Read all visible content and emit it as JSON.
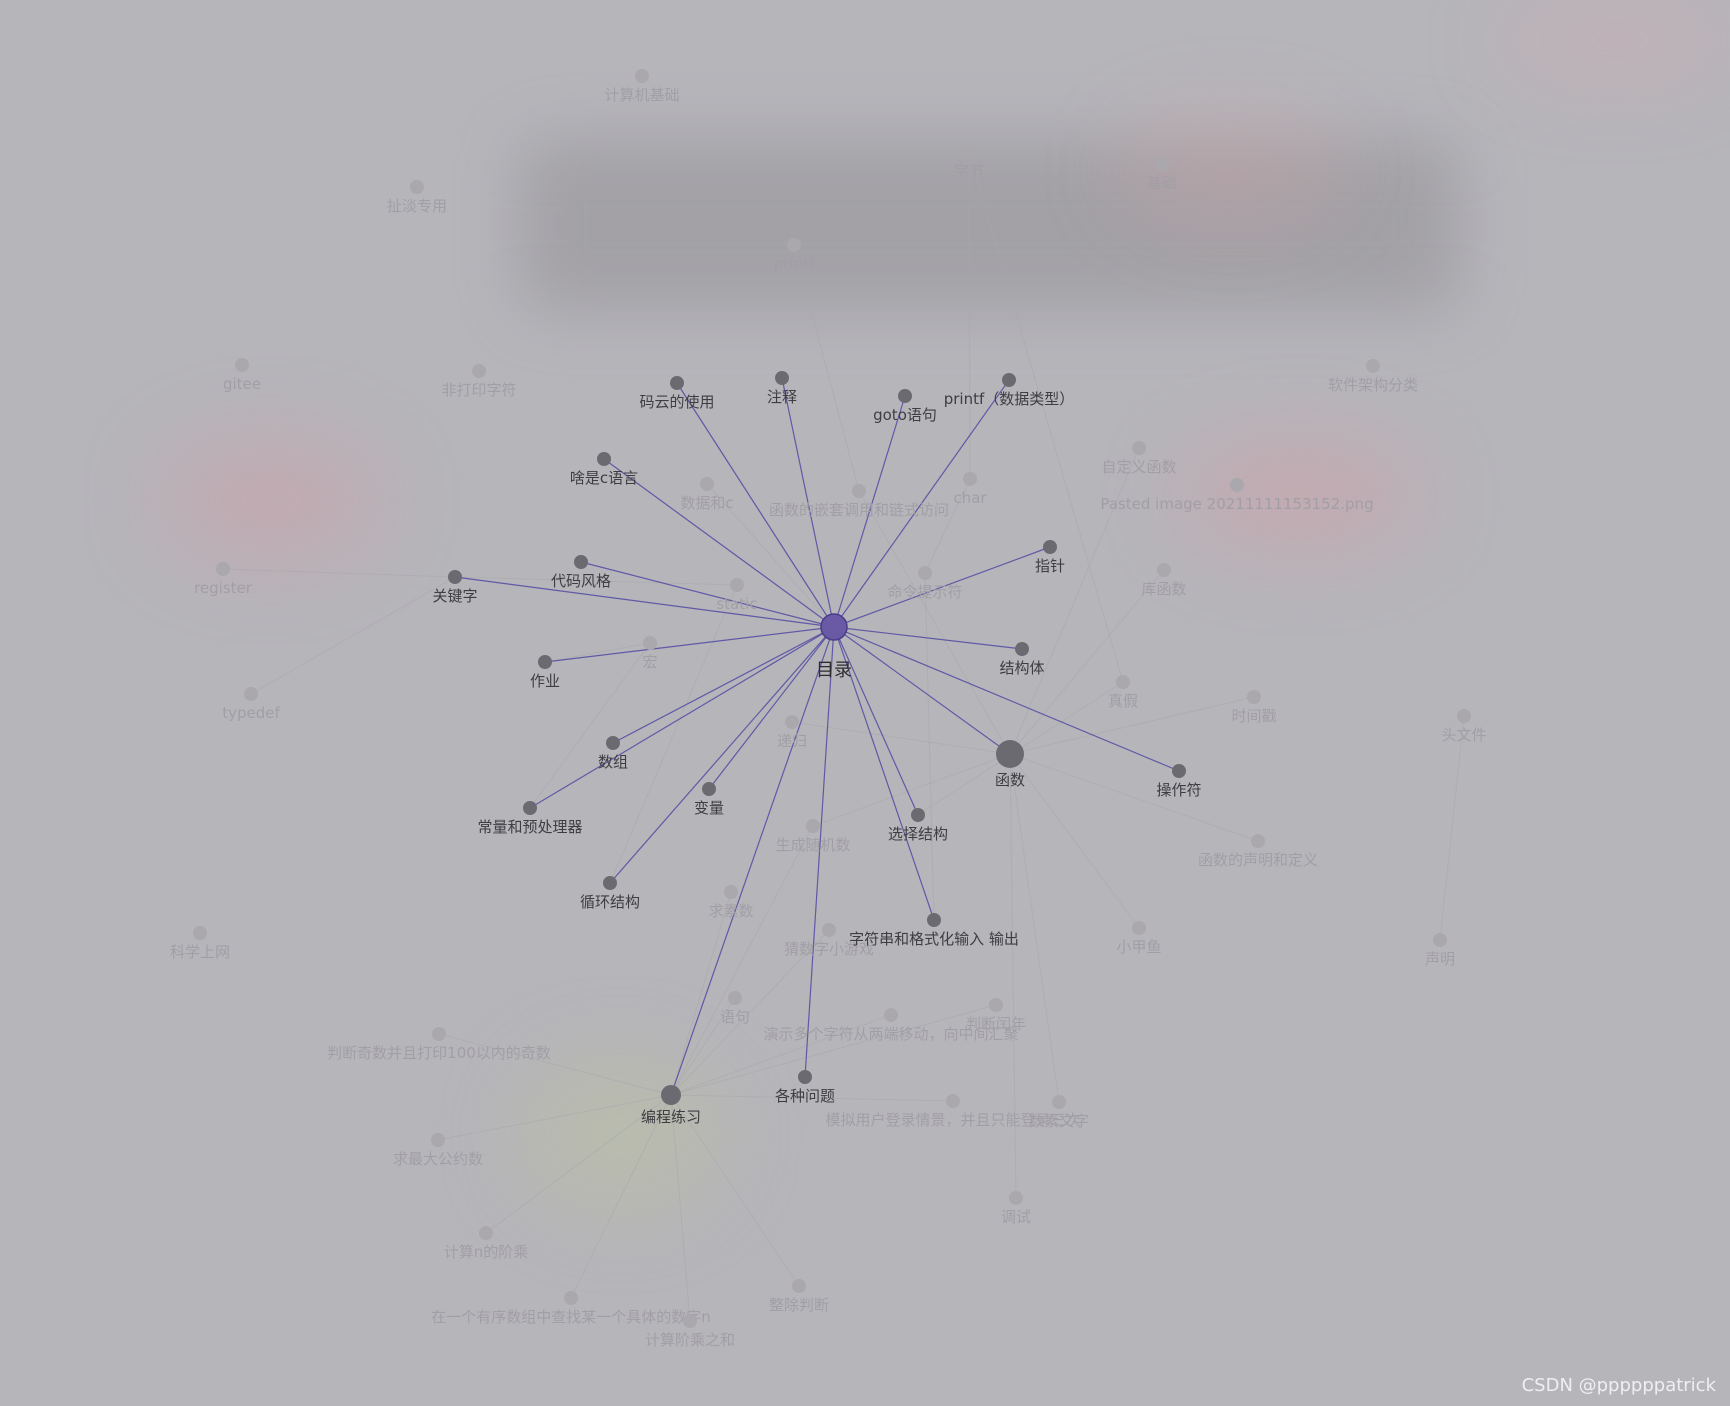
{
  "graph": {
    "center": {
      "id": "mulu",
      "label": "目录"
    },
    "active_nodes": [
      {
        "id": "mayun",
        "label": "码云的使用"
      },
      {
        "id": "zhushi",
        "label": "注释"
      },
      {
        "id": "goto",
        "label": "goto语句"
      },
      {
        "id": "printf_types",
        "label": "printf（数据类型）"
      },
      {
        "id": "c_lang",
        "label": "啥是c语言"
      },
      {
        "id": "zhizhen",
        "label": "指针"
      },
      {
        "id": "daima",
        "label": "代码风格"
      },
      {
        "id": "guanjianzi",
        "label": "关键字"
      },
      {
        "id": "jiegouti",
        "label": "结构体"
      },
      {
        "id": "zuoye",
        "label": "作业"
      },
      {
        "id": "hanshu",
        "label": "函数"
      },
      {
        "id": "caozuofu",
        "label": "操作符"
      },
      {
        "id": "shuzu",
        "label": "数组"
      },
      {
        "id": "bianliang",
        "label": "变量"
      },
      {
        "id": "xuanze",
        "label": "选择结构"
      },
      {
        "id": "changliang",
        "label": "常量和预处理器"
      },
      {
        "id": "xunhuan",
        "label": "循环结构"
      },
      {
        "id": "zifuchuan",
        "label": "字符串和格式化输入 输出"
      },
      {
        "id": "gezhong",
        "label": "各种问题"
      },
      {
        "id": "biancheng",
        "label": "编程练习"
      }
    ],
    "faint_nodes": [
      {
        "id": "jisuanji",
        "label": "计算机基础"
      },
      {
        "id": "zijie",
        "label": "字节"
      },
      {
        "id": "jichu",
        "label": "基础"
      },
      {
        "id": "chedan",
        "label": "扯淡专用"
      },
      {
        "id": "printf",
        "label": "printf"
      },
      {
        "id": "gitee",
        "label": "gitee"
      },
      {
        "id": "feida",
        "label": "非打印字符"
      },
      {
        "id": "ruanjian",
        "label": "软件架构分类"
      },
      {
        "id": "zidingyi",
        "label": "自定义函数"
      },
      {
        "id": "shujuhe",
        "label": "数据和c"
      },
      {
        "id": "qiantao",
        "label": "函数的嵌套调用和链式访问"
      },
      {
        "id": "char",
        "label": "char"
      },
      {
        "id": "pasted",
        "label": "Pasted image 20211111153152.png"
      },
      {
        "id": "register",
        "label": "register"
      },
      {
        "id": "static",
        "label": "static"
      },
      {
        "id": "mingling",
        "label": "命令提示符"
      },
      {
        "id": "kuhanshu",
        "label": "库函数"
      },
      {
        "id": "hong",
        "label": "宏"
      },
      {
        "id": "zhenjia",
        "label": "真假"
      },
      {
        "id": "shijianchuo",
        "label": "时间戳"
      },
      {
        "id": "typedef",
        "label": "typedef"
      },
      {
        "id": "toufile",
        "label": "头文件"
      },
      {
        "id": "digui",
        "label": "递归"
      },
      {
        "id": "suiji",
        "label": "生成随机数"
      },
      {
        "id": "shengming_dingyi",
        "label": "函数的声明和定义"
      },
      {
        "id": "sushu",
        "label": "求素数"
      },
      {
        "id": "kexue",
        "label": "科学上网"
      },
      {
        "id": "caishuzi",
        "label": "猜数字小游戏"
      },
      {
        "id": "xiaojiayu",
        "label": "小甲鱼"
      },
      {
        "id": "shengming",
        "label": "声明"
      },
      {
        "id": "yuju",
        "label": "语句"
      },
      {
        "id": "yanshi",
        "label": "演示多个字符从两端移动，向中间汇聚"
      },
      {
        "id": "runnian",
        "label": "判断闰年"
      },
      {
        "id": "qishu",
        "label": "判断奇数并且打印100以内的奇数"
      },
      {
        "id": "moni",
        "label": "模拟用户登录情景，并且只能登录三次"
      },
      {
        "id": "shuru",
        "label": "数素文字"
      },
      {
        "id": "gongyueshu",
        "label": "求最大公约数"
      },
      {
        "id": "tiaoshi",
        "label": "调试"
      },
      {
        "id": "jiecheng",
        "label": "计算n的阶乘"
      },
      {
        "id": "zhengchu",
        "label": "整除判断"
      },
      {
        "id": "chazhao",
        "label": "在一个有序数组中查找某一个具体的数字n"
      },
      {
        "id": "jiecheng_he",
        "label": "计算阶乘之和"
      }
    ]
  },
  "watermark": "CSDN @ppppppatrick",
  "colors": {
    "accent": "#6a5aa6",
    "edge": "#5f59a6",
    "background": "#b6b5ba"
  }
}
